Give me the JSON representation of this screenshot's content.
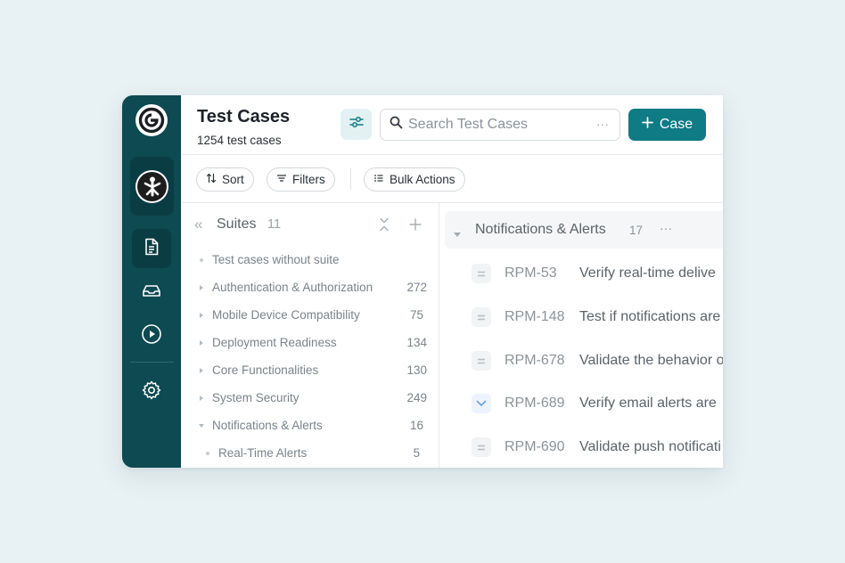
{
  "colors": {
    "page_bg": "#e8f1f3",
    "sidebar_bg": "#0d4a51",
    "accent": "#0f7b85"
  },
  "sidebar": {
    "logo_icon": "brand-logo-icon",
    "project_icon": "project-avatar-icon",
    "items": [
      {
        "icon": "document-icon",
        "active": true
      },
      {
        "icon": "inbox-icon",
        "active": false
      },
      {
        "icon": "play-circle-icon",
        "active": false
      },
      {
        "icon": "gear-icon",
        "active": false
      }
    ]
  },
  "header": {
    "title": "Test Cases",
    "count": "1254",
    "count_label": "test cases",
    "search_placeholder": "Search Test Cases",
    "search_more": "···",
    "new_case_label": "Case"
  },
  "toolbar": {
    "sort_label": "Sort",
    "filters_label": "Filters",
    "bulk_actions_label": "Bulk Actions"
  },
  "suites": {
    "label": "Suites",
    "count": "11",
    "items": [
      {
        "name": "Test cases without suite",
        "count": "",
        "marker": "dot",
        "child": false
      },
      {
        "name": "Authentication & Authorization",
        "count": "272",
        "marker": "right",
        "child": false
      },
      {
        "name": "Mobile Device Compatibility",
        "count": "75",
        "marker": "right",
        "child": false
      },
      {
        "name": "Deployment Readiness",
        "count": "134",
        "marker": "right",
        "child": false
      },
      {
        "name": "Core Functionalities",
        "count": "130",
        "marker": "right",
        "child": false
      },
      {
        "name": "System Security",
        "count": "249",
        "marker": "right",
        "child": false
      },
      {
        "name": "Notifications & Alerts",
        "count": "16",
        "marker": "down",
        "child": false
      },
      {
        "name": "Real-Time Alerts",
        "count": "5",
        "marker": "dot",
        "child": true
      }
    ]
  },
  "cases_panel": {
    "group_name": "Notifications & Alerts",
    "group_count": "17",
    "group_more": "···",
    "rows": [
      {
        "id": "RPM-53",
        "title": "Verify real-time delive",
        "priority": "medium"
      },
      {
        "id": "RPM-148",
        "title": "Test if notifications are",
        "priority": "medium"
      },
      {
        "id": "RPM-678",
        "title": "Validate the behavior o",
        "priority": "medium"
      },
      {
        "id": "RPM-689",
        "title": "Verify email alerts are",
        "priority": "low"
      },
      {
        "id": "RPM-690",
        "title": "Validate push notificati",
        "priority": "medium"
      }
    ]
  }
}
